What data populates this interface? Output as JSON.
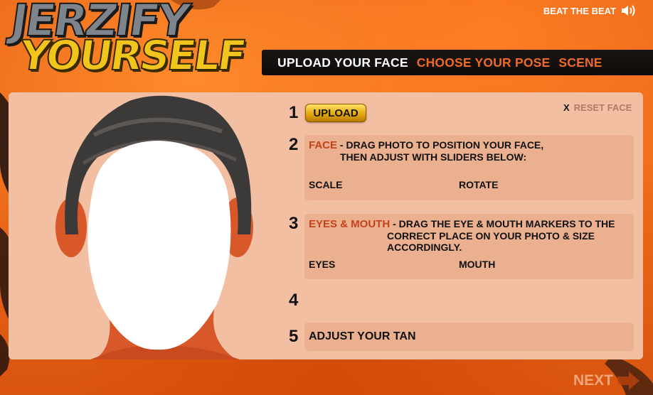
{
  "logo": {
    "line1": "JERZIFY",
    "line2": "YOURSELF"
  },
  "header": {
    "beat_label": "BEAT THE BEAT",
    "sound_icon": "speaker-icon"
  },
  "nav": {
    "tabs": [
      {
        "label": "UPLOAD YOUR FACE",
        "state": "active"
      },
      {
        "label": "CHOOSE YOUR POSE",
        "state": "inactive"
      },
      {
        "label": "SCENE",
        "state": "inactive"
      }
    ]
  },
  "steps": {
    "s1": {
      "num": "1",
      "button": "UPLOAD"
    },
    "reset": {
      "x": "X",
      "label": "RESET FACE"
    },
    "s2": {
      "num": "2",
      "title": "FACE",
      "desc_line1": "- DRAG PHOTO TO POSITION YOUR FACE,",
      "desc_line2": "THEN ADJUST WITH SLIDERS BELOW:",
      "scale": "SCALE",
      "rotate": "ROTATE"
    },
    "s3": {
      "num": "3",
      "title": "EYES & MOUTH",
      "desc_line1": "- DRAG THE EYE & MOUTH MARKERS TO THE",
      "desc_line2": "CORRECT PLACE ON YOUR PHOTO & SIZE ACCORDINGLY.",
      "eyes": "EYES",
      "mouth": "MOUTH"
    },
    "s4": {
      "num": "4"
    },
    "s5": {
      "num": "5",
      "label": "ADJUST YOUR TAN"
    }
  },
  "footer": {
    "next": "NEXT"
  },
  "colors": {
    "accent_orange": "#ee6a28",
    "panel": "#f3bfa2",
    "box": "#ebb08f",
    "button_gold": "#e3a90f"
  }
}
